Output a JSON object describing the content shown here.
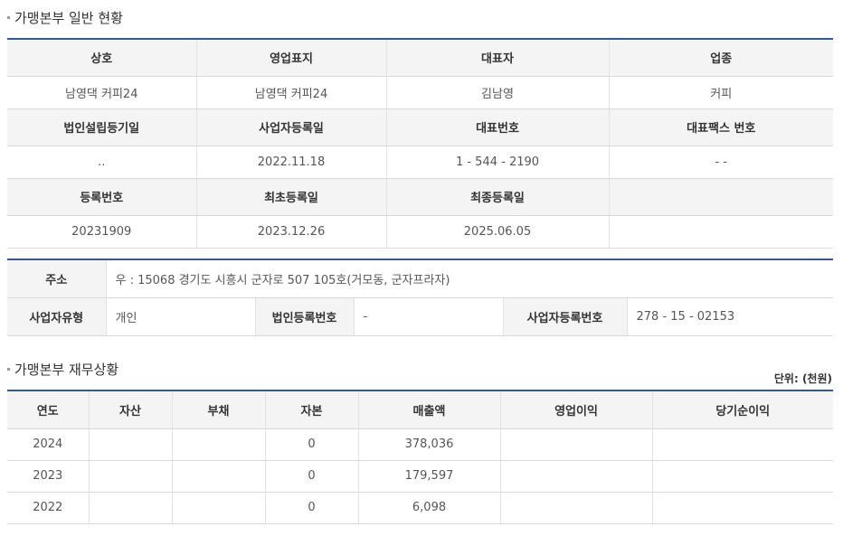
{
  "general": {
    "title": "가맹본부 일반 현황",
    "rows": [
      {
        "h": [
          "상호",
          "영업표지",
          "대표자",
          "업종"
        ],
        "d": [
          "남영댁 커피24",
          "남영댁 커피24",
          "김남영",
          "커피"
        ]
      },
      {
        "h": [
          "법인설립등기일",
          "사업자등록일",
          "대표번호",
          "대표팩스 번호"
        ],
        "d": [
          "..",
          "2022.11.18",
          "1  -  544  -  2190",
          "-   -"
        ]
      },
      {
        "h": [
          "등록번호",
          "최초등록일",
          "최종등록일",
          ""
        ],
        "d": [
          "20231909",
          "2023.12.26",
          "2025.06.05",
          ""
        ]
      }
    ]
  },
  "address": {
    "label": "주소",
    "value": "우 : 15068 경기도 시흥시 군자로 507 105호(거모동, 군자프라자)",
    "biz_type_label": "사업자유형",
    "biz_type_value": "개인",
    "corp_reg_label": "법인등록번호",
    "corp_reg_value": "-",
    "biz_reg_label": "사업자등록번호",
    "biz_reg_value": "278  -  15  -  02153"
  },
  "finance": {
    "title": "가맹본부 재무상황",
    "unit": "단위: (천원)",
    "headers": [
      "연도",
      "자산",
      "부채",
      "자본",
      "매출액",
      "영업이익",
      "당기순이익"
    ],
    "rows": [
      [
        "2024",
        "",
        "",
        "0",
        "378,036",
        "",
        ""
      ],
      [
        "2023",
        "",
        "",
        "0",
        "179,597",
        "",
        ""
      ],
      [
        "2022",
        "",
        "",
        "0",
        "6,098",
        "",
        ""
      ]
    ]
  }
}
